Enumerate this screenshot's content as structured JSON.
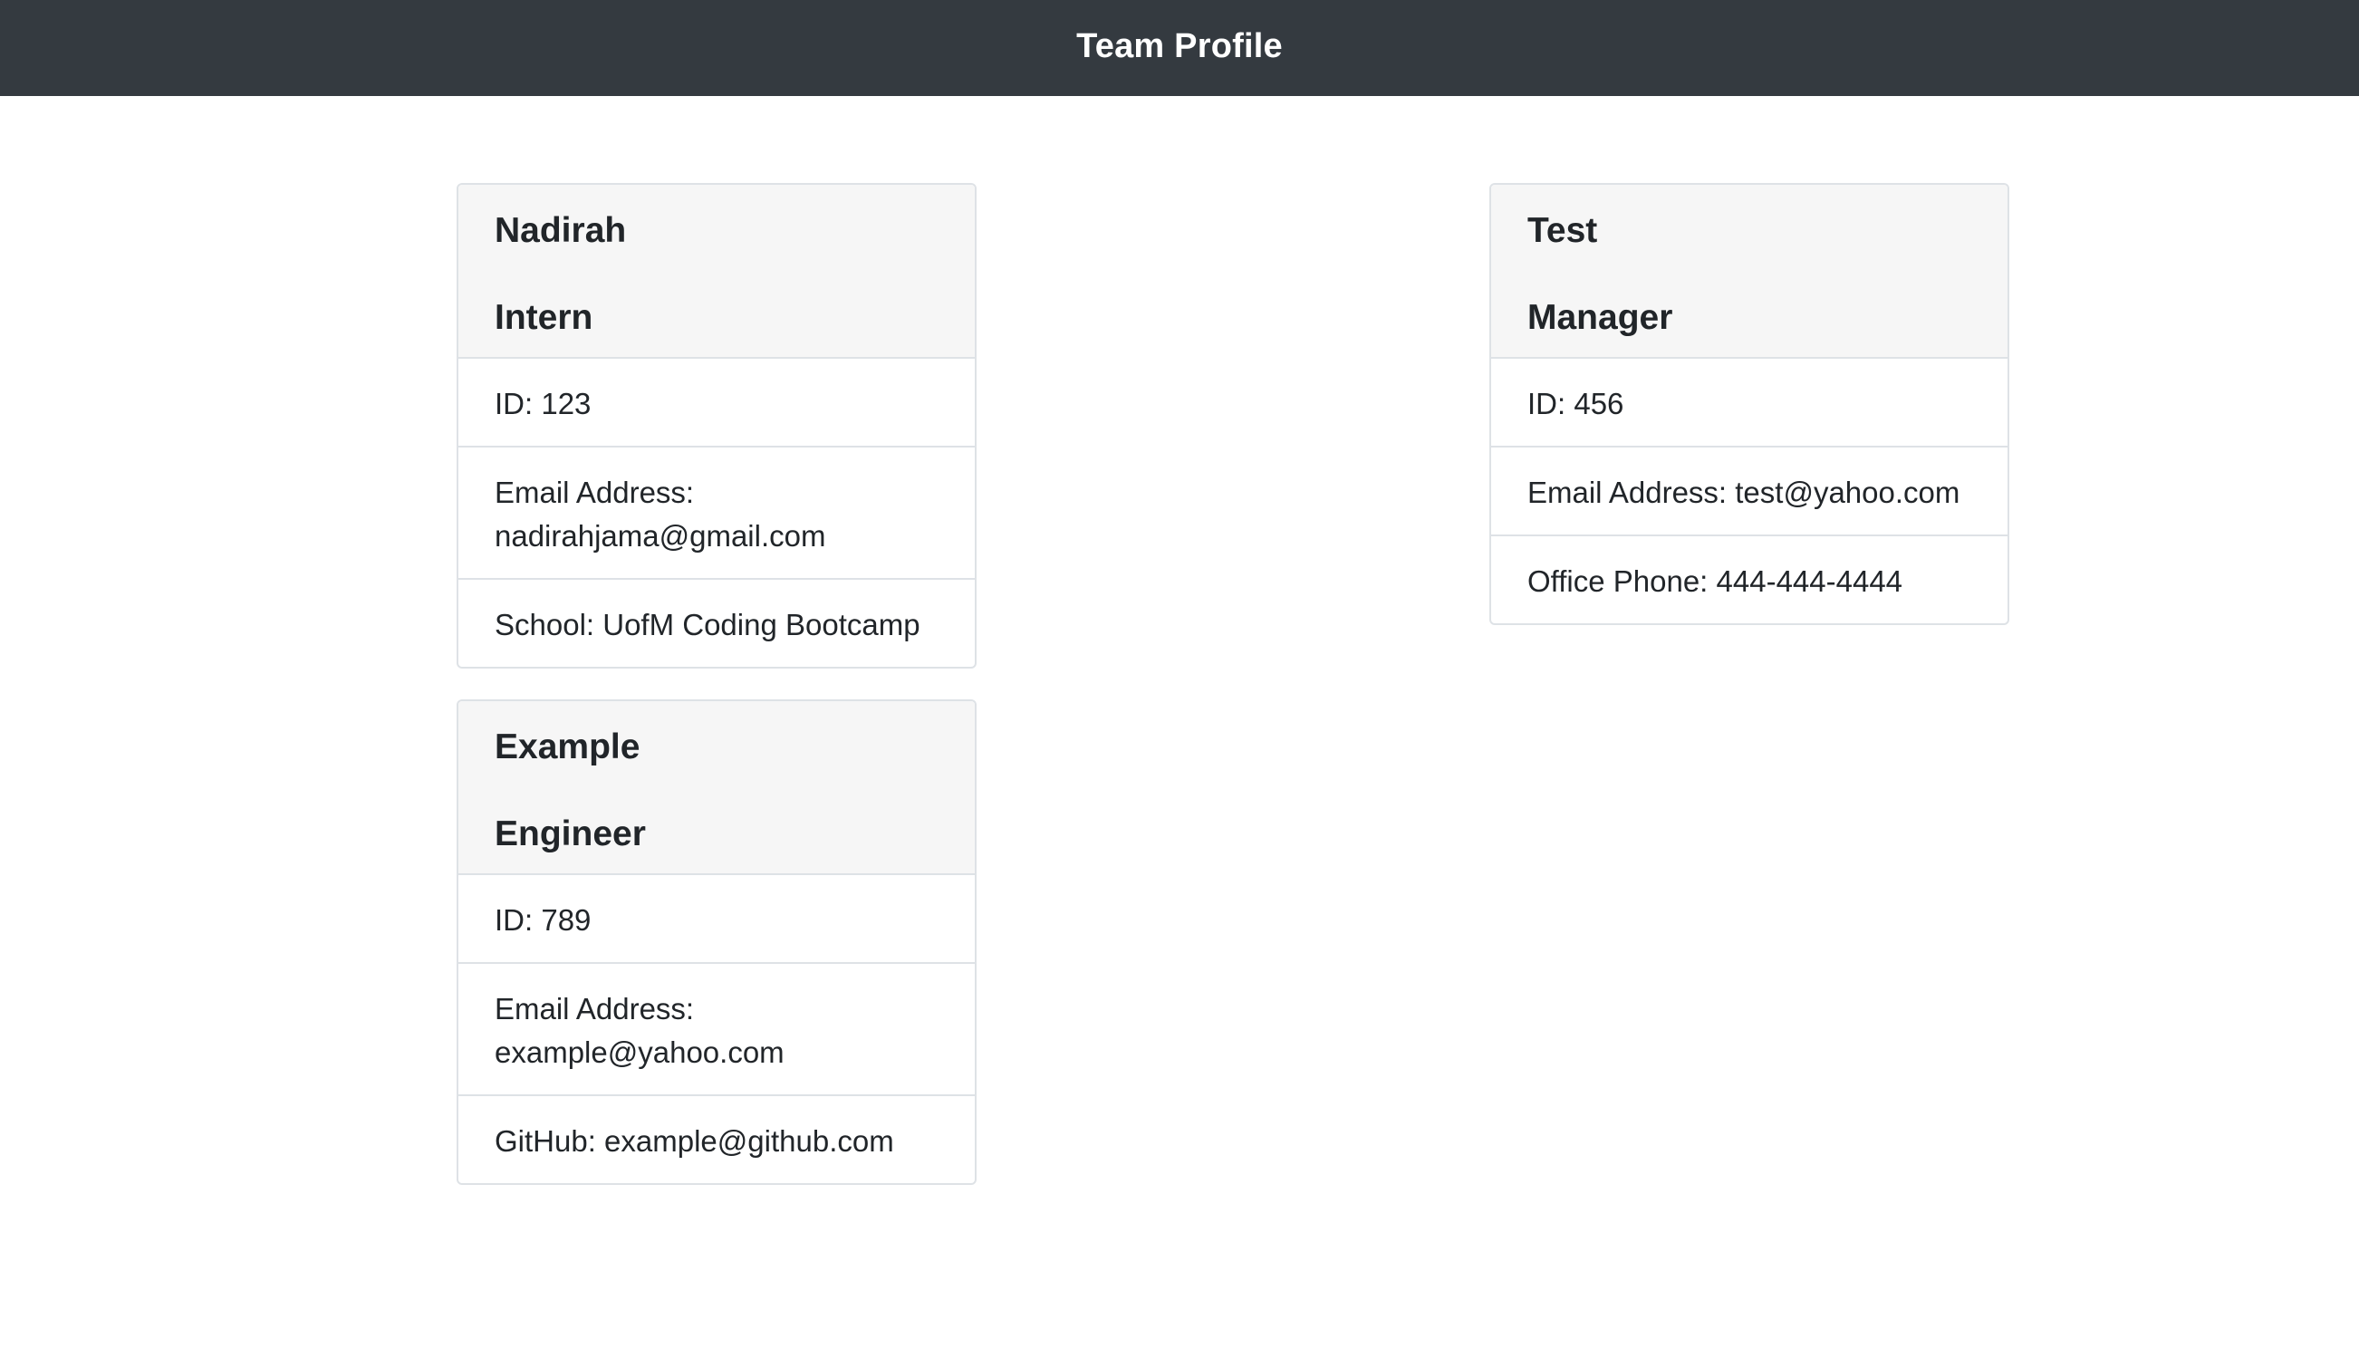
{
  "header": {
    "title": "Team Profile"
  },
  "cards": [
    {
      "name": "Nadirah",
      "role": "Intern",
      "id_text": "ID: 123",
      "email_label": "Email Address:",
      "email": "nadirahjama@gmail.com",
      "extra": "School: UofM Coding Bootcamp"
    },
    {
      "name": "Test",
      "role": "Manager",
      "id_text": "ID: 456",
      "email_label": "Email Address:",
      "email": "test@yahoo.com",
      "extra": "Office Phone: 444-444-4444"
    },
    {
      "name": "Example",
      "role": "Engineer",
      "id_text": "ID: 789",
      "email_label": "Email Address:",
      "email": "example@yahoo.com",
      "extra": "GitHub: example@github.com"
    }
  ]
}
